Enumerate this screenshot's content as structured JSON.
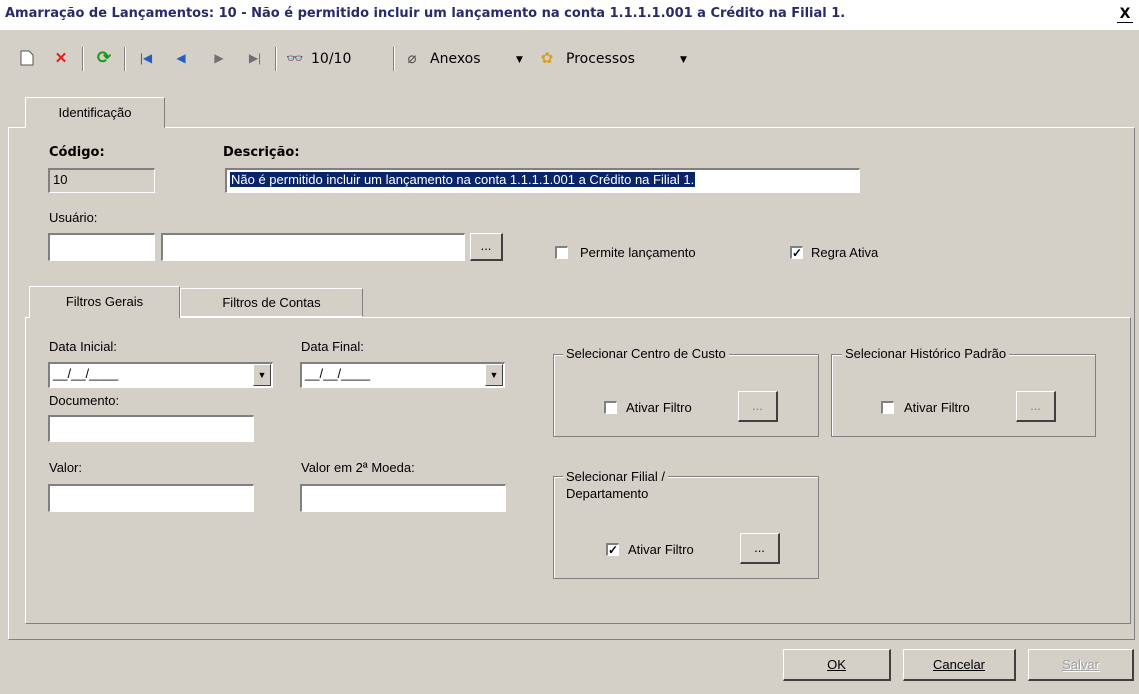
{
  "window": {
    "title": "Amarração de Lançamentos: 10 - Não é permitido incluir um lançamento na conta 1.1.1.1.001 a Crédito na Filial 1.",
    "close_glyph": "X"
  },
  "toolbar": {
    "record_counter": "10/10",
    "attachments_label": "Anexos",
    "processes_label": "Processos"
  },
  "tabs_top": [
    {
      "label": "Identificação"
    }
  ],
  "identificacao": {
    "codigo_label": "Código:",
    "codigo_value": "10",
    "descricao_label": "Descrição:",
    "descricao_value": "Não é permitido incluir um lançamento na conta 1.1.1.1.001 a Crédito na Filial 1.",
    "usuario_label": "Usuário:",
    "usuario_code": "",
    "usuario_name": "",
    "lookup_button": "...",
    "permite_lancamento_label": "Permite lançamento",
    "permite_lancamento_checked": false,
    "regra_ativa_label": "Regra Ativa",
    "regra_ativa_checked": true
  },
  "tabs_inner": [
    {
      "label": "Filtros Gerais"
    },
    {
      "label": "Filtros de Contas"
    }
  ],
  "filtros": {
    "data_inicial_label": "Data Inicial:",
    "data_inicial_value": "__/__/____",
    "data_final_label": "Data Final:",
    "data_final_value": "__/__/____",
    "documento_label": "Documento:",
    "documento_value": "",
    "valor_label": "Valor:",
    "valor_value": "",
    "valor_moeda_label": "Valor em 2ª Moeda:",
    "valor_moeda_value": "",
    "centro_custo_title": "Selecionar Centro de Custo",
    "historico_title": "Selecionar Histórico Padrão",
    "filial_title_1": "Selecionar Filial /",
    "filial_title_2": "Departamento",
    "ativar_filtro_label": "Ativar Filtro",
    "centro_custo_checked": false,
    "historico_checked": false,
    "filial_checked": true,
    "lookup_button": "..."
  },
  "footer": {
    "ok_label": "OK",
    "cancel_label": "Cancelar",
    "save_label": "Salvar"
  },
  "icons": [
    "new-document-icon",
    "delete-icon",
    "refresh-icon",
    "first-record-icon",
    "previous-record-icon",
    "next-record-icon",
    "last-record-icon",
    "search-binoculars-icon",
    "attachment-clip-icon",
    "processes-gear-icon",
    "dropdown-arrow-icon"
  ],
  "colors": {
    "selection": "#0a246a",
    "title_text": "#2a2a6a",
    "delete_red": "#e02020"
  }
}
